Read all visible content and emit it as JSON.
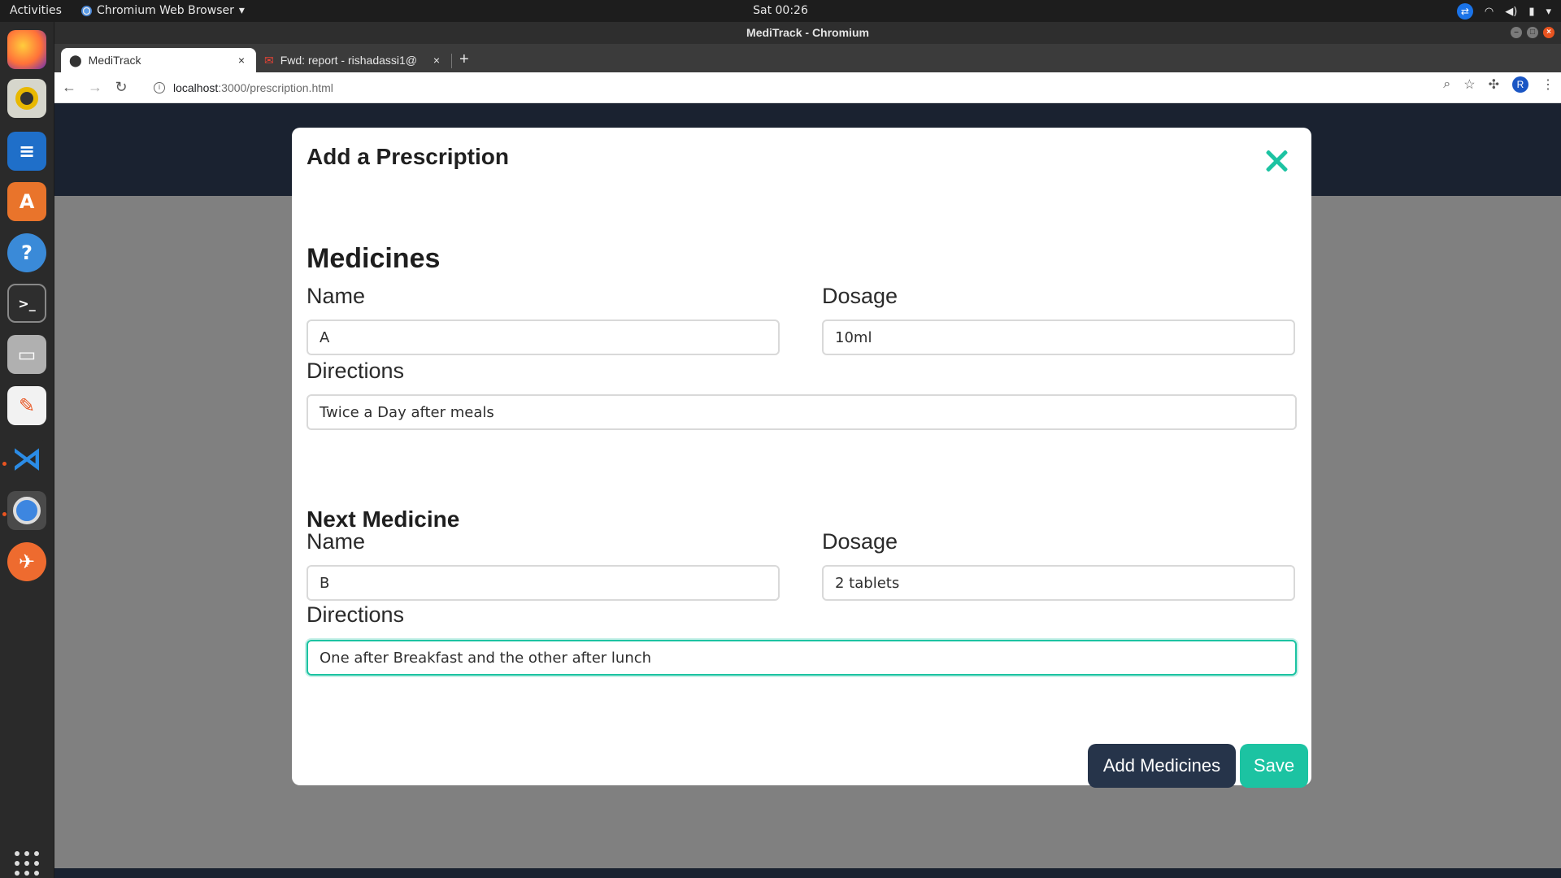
{
  "topbar": {
    "activities": "Activities",
    "app_name": "Chromium Web Browser",
    "app_menu_arrow": "▾",
    "clock": "Sat 00:26"
  },
  "window": {
    "title": "MediTrack - Chromium"
  },
  "tabs": [
    {
      "title": "MediTrack",
      "active": true
    },
    {
      "title": "Fwd: report - rishadassi1@",
      "active": false
    }
  ],
  "toolbar": {
    "url_host": "localhost",
    "url_path": ":3000/prescription.html",
    "profile_initial": "R"
  },
  "modal": {
    "title": "Add a Prescription",
    "section1_heading": "Medicines",
    "section2_heading": "Next Medicine",
    "name_label": "Name",
    "dosage_label": "Dosage",
    "directions_label": "Directions",
    "medicine1": {
      "name": "A",
      "dosage": "10ml",
      "directions": "Twice a Day after meals"
    },
    "medicine2": {
      "name": "B",
      "dosage": "2 tablets",
      "directions": "One after Breakfast and the other after lunch"
    },
    "add_button": "Add Medicines",
    "save_button": "Save"
  },
  "colors": {
    "accent": "#1cc3a2",
    "primary_dark": "#26344a",
    "page_header": "#1a2230"
  }
}
